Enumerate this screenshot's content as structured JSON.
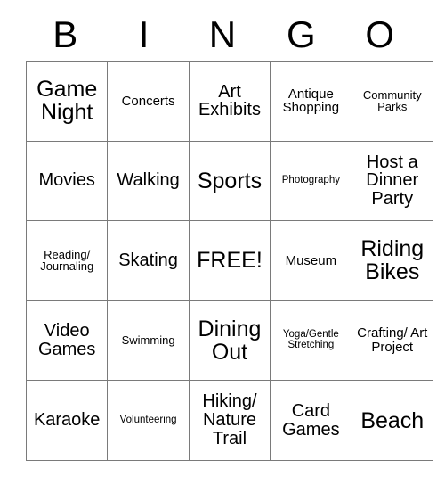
{
  "card": {
    "title_letters": [
      "B",
      "I",
      "N",
      "G",
      "O"
    ],
    "rows": [
      [
        {
          "label": "Game Night",
          "size": "fs-xl"
        },
        {
          "label": "Concerts",
          "size": "fs-sm"
        },
        {
          "label": "Art Exhibits",
          "size": "fs-md"
        },
        {
          "label": "Antique Shopping",
          "size": "fs-sm"
        },
        {
          "label": "Community Parks",
          "size": "fs-xs"
        }
      ],
      [
        {
          "label": "Movies",
          "size": "fs-md"
        },
        {
          "label": "Walking",
          "size": "fs-md"
        },
        {
          "label": "Sports",
          "size": "fs-xl"
        },
        {
          "label": "Photography",
          "size": "fs-xxs"
        },
        {
          "label": "Host a Dinner Party",
          "size": "fs-md"
        }
      ],
      [
        {
          "label": "Reading/ Journaling",
          "size": "fs-xs"
        },
        {
          "label": "Skating",
          "size": "fs-md"
        },
        {
          "label": "FREE!",
          "size": "fs-xl"
        },
        {
          "label": "Museum",
          "size": "fs-sm"
        },
        {
          "label": "Riding Bikes",
          "size": "fs-xl"
        }
      ],
      [
        {
          "label": "Video Games",
          "size": "fs-md"
        },
        {
          "label": "Swimming",
          "size": "fs-xs"
        },
        {
          "label": "Dining Out",
          "size": "fs-xl"
        },
        {
          "label": "Yoga/Gentle Stretching",
          "size": "fs-xxs"
        },
        {
          "label": "Crafting/ Art Project",
          "size": "fs-sm"
        }
      ],
      [
        {
          "label": "Karaoke",
          "size": "fs-md"
        },
        {
          "label": "Volunteering",
          "size": "fs-xxs"
        },
        {
          "label": "Hiking/ Nature Trail",
          "size": "fs-md"
        },
        {
          "label": "Card Games",
          "size": "fs-md"
        },
        {
          "label": "Beach",
          "size": "fs-xl"
        }
      ]
    ],
    "colors": {
      "background": "#ffffff",
      "text": "#000000",
      "grid_line": "#7a7a7a"
    }
  }
}
